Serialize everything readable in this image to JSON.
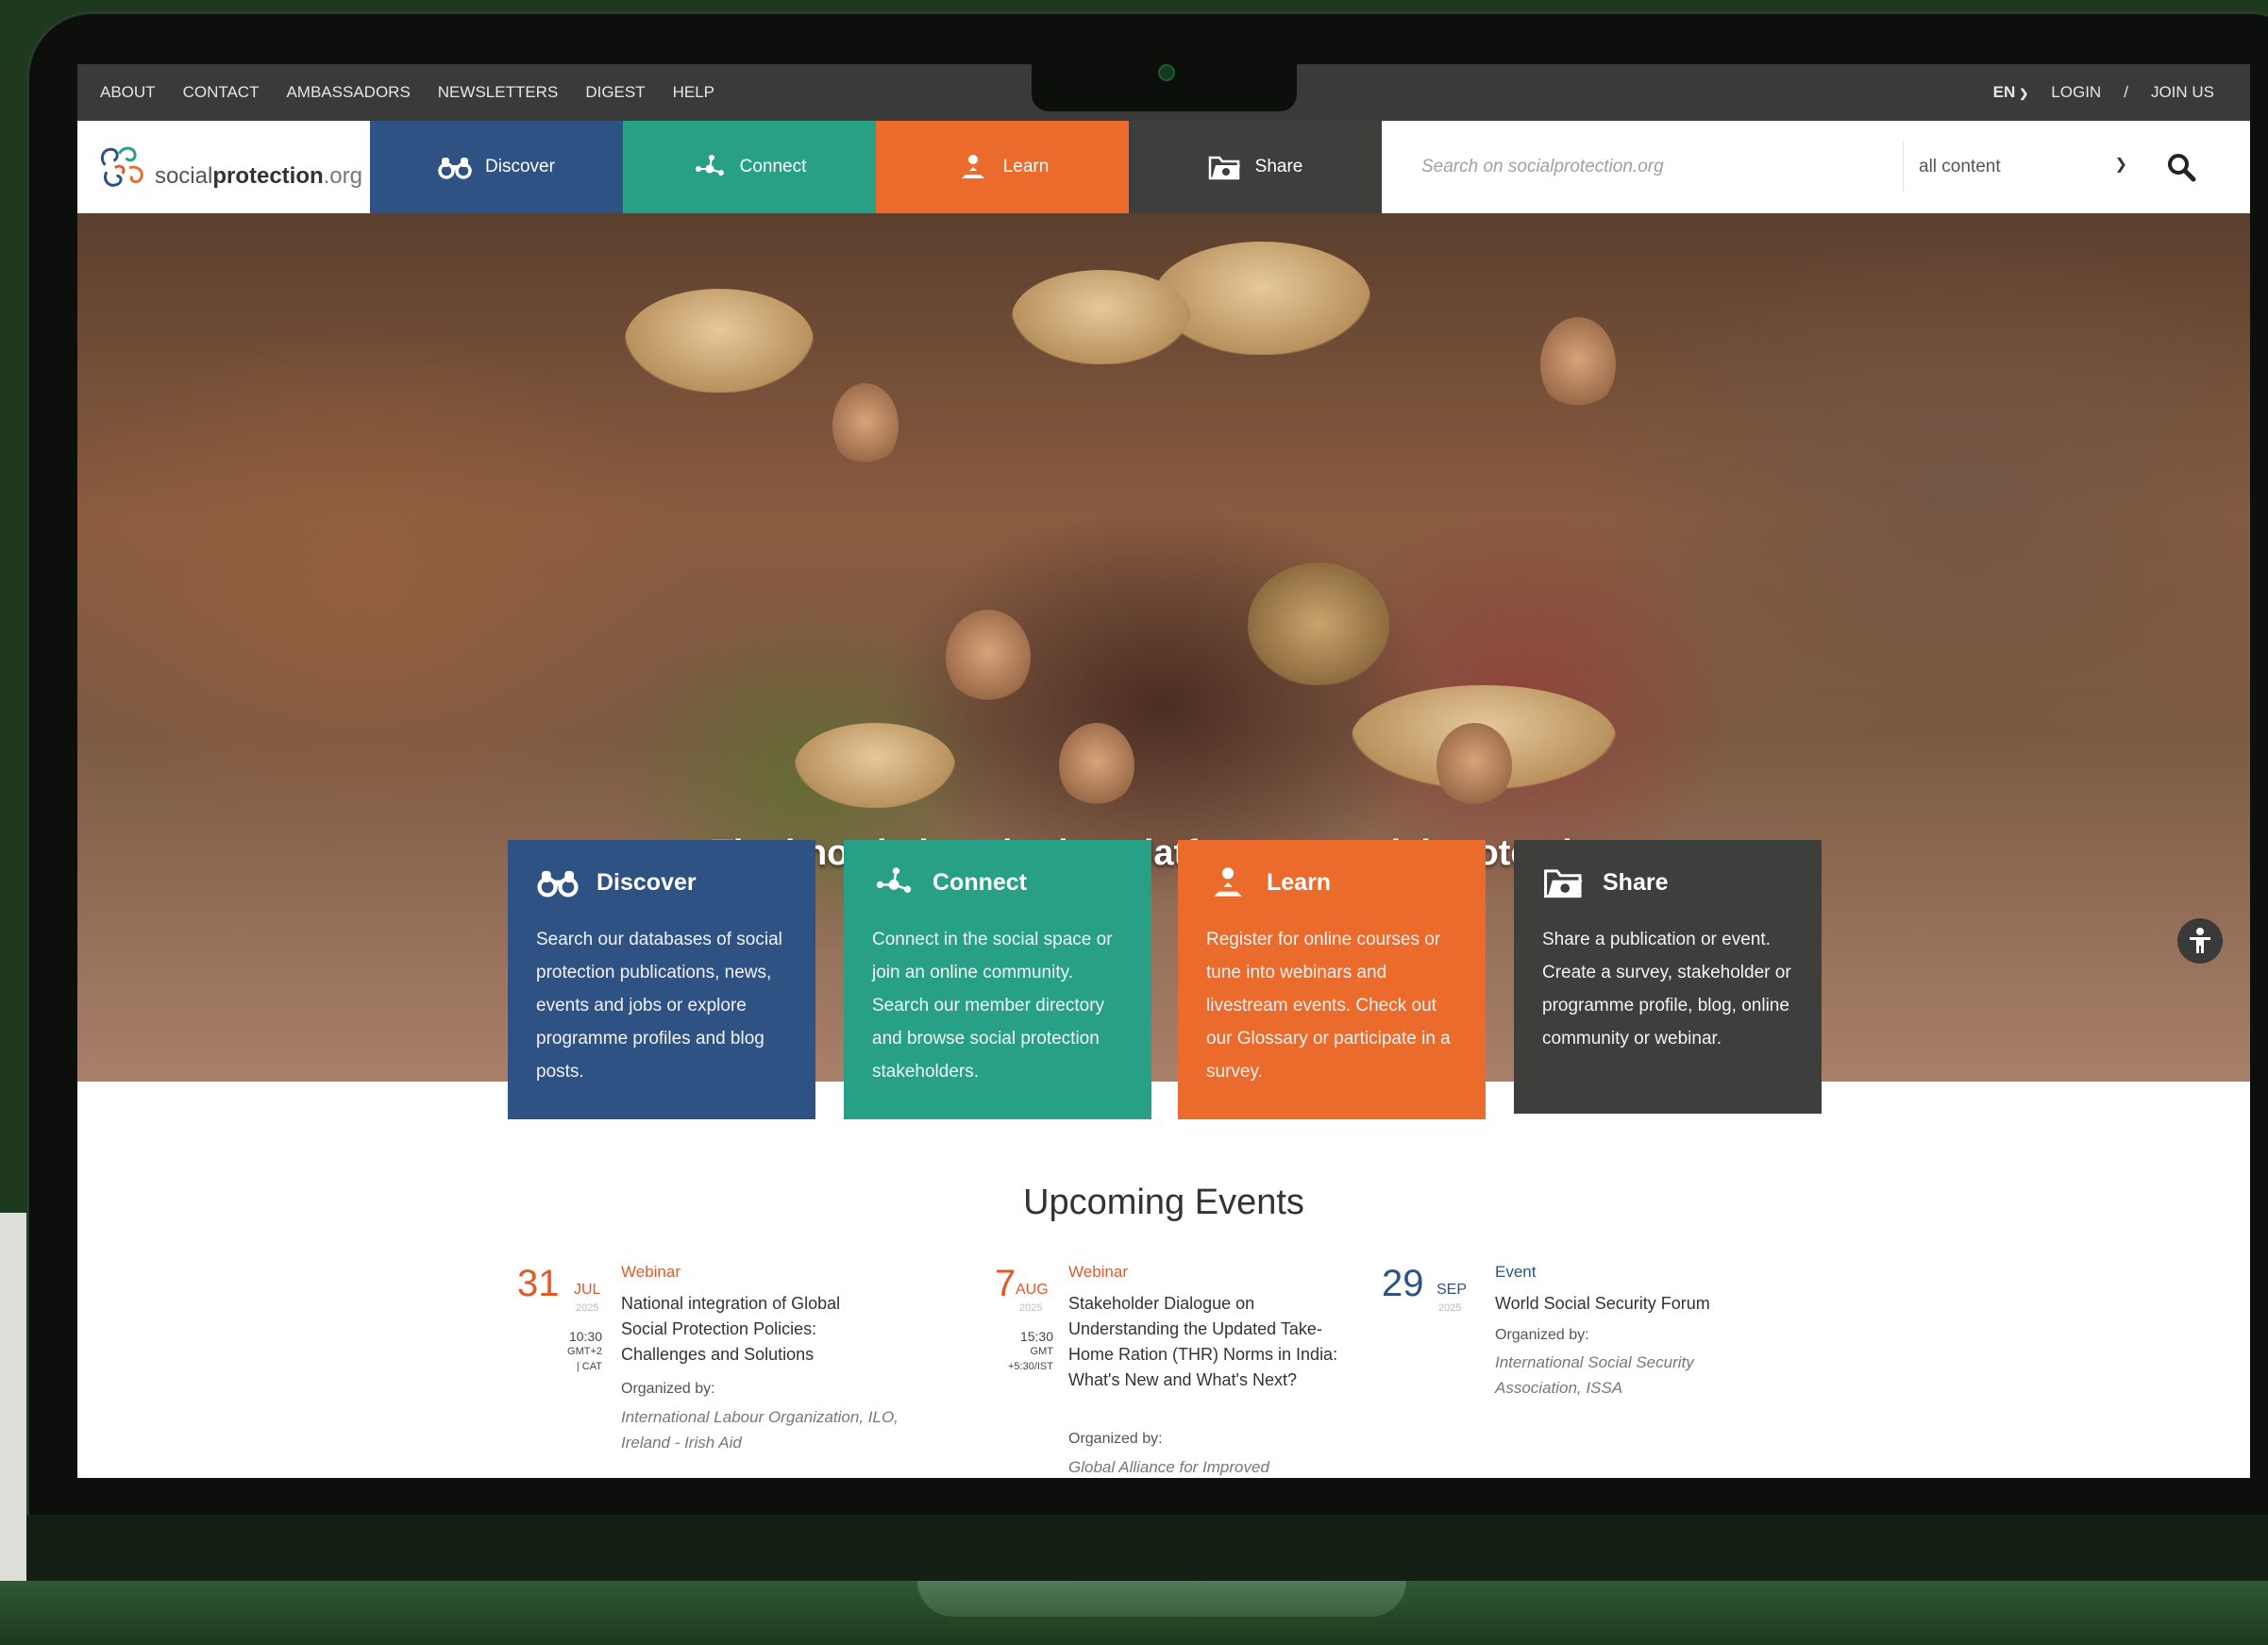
{
  "utility_nav": {
    "links": [
      "ABOUT",
      "CONTACT",
      "AMBASSADORS",
      "NEWSLETTERS",
      "DIGEST",
      "HELP"
    ],
    "language": "EN",
    "login": "LOGIN",
    "separator": "/",
    "join": "JOIN US"
  },
  "logo": {
    "part1": "social",
    "part2": "protection",
    "part3": ".org"
  },
  "main_nav": {
    "discover": "Discover",
    "connect": "Connect",
    "learn": "Learn",
    "share": "Share"
  },
  "search": {
    "placeholder": "Search on socialprotection.org",
    "filter_value": "all content"
  },
  "hero": {
    "title": "The knowledge-sharing platform on social protection"
  },
  "cards": [
    {
      "title": "Discover",
      "text": "Search our databases of social protection publications, news, events and jobs or explore programme profiles and blog posts.",
      "color": "#2f5284"
    },
    {
      "title": "Connect",
      "text": "Connect in the social space or join an online community. Search our member directory and browse social protection stakeholders.",
      "color": "#27a086"
    },
    {
      "title": "Learn",
      "text": "Register for online courses or tune into webinars and livestream events. Check out our Glossary or participate in a survey.",
      "color": "#eb6b2d"
    },
    {
      "title": "Share",
      "text": "Share a publication or event. Create a survey, stakeholder or programme profile, blog, online community or webinar.",
      "color": "#3e3e3c"
    }
  ],
  "events": {
    "heading": "Upcoming Events",
    "items": [
      {
        "day": "31",
        "month": "JUL",
        "year": "2025",
        "time": [
          "10:30",
          "GMT+2",
          "| CAT"
        ],
        "type": "Webinar",
        "title": "National integration of Global Social Protection Policies: Challenges and Solutions",
        "org_label": "Organized by:",
        "org": "International Labour Organization, ILO, Ireland - Irish Aid"
      },
      {
        "day": "7",
        "month": "AUG",
        "year": "2025",
        "time": [
          "15:30",
          "GMT",
          "+5:30/IST"
        ],
        "type": "Webinar",
        "title": "Stakeholder Dialogue on Understanding the Updated Take-Home Ration (THR) Norms in India: What's New and What's Next?",
        "org_label": "Organized by:",
        "org": "Global Alliance for Improved"
      },
      {
        "day": "29",
        "month": "SEP",
        "year": "2025",
        "time": [],
        "type": "Event",
        "title": "World Social Security Forum",
        "org_label": "Organized by:",
        "org": "International Social Security Association, ISSA"
      }
    ]
  },
  "colors": {
    "discover": "#2f5284",
    "connect": "#27a086",
    "learn": "#eb6b2d",
    "share": "#3e3e3c",
    "event_accent": "#e05a2a"
  }
}
